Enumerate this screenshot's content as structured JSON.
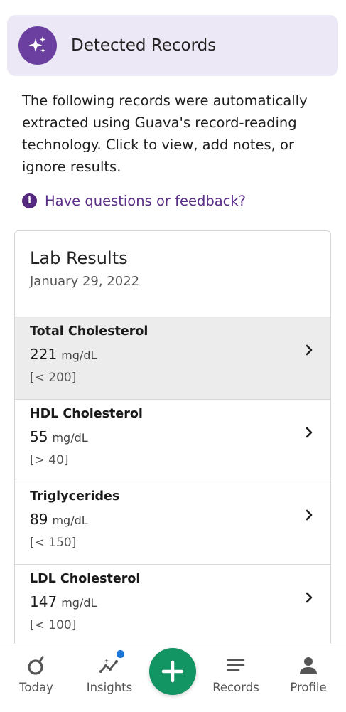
{
  "header": {
    "title": "Detected Records",
    "icon": "sparkle-icon",
    "badge_color": "#6b3fa0"
  },
  "intro_text": "The following records were automatically extracted using Guava's record-reading technology. Click to view, add notes, or ignore results.",
  "feedback_link": {
    "label": "Have questions or feedback?",
    "icon": "info-icon",
    "color": "#5a2d87"
  },
  "lab_results": {
    "title": "Lab Results",
    "date": "January 29, 2022",
    "items": [
      {
        "name": "Total Cholesterol",
        "value": "221",
        "unit": "mg/dL",
        "range": "[< 200]"
      },
      {
        "name": "HDL Cholesterol",
        "value": "55",
        "unit": "mg/dL",
        "range": "[> 40]"
      },
      {
        "name": "Triglycerides",
        "value": "89",
        "unit": "mg/dL",
        "range": "[< 150]"
      },
      {
        "name": "LDL Cholesterol",
        "value": "147",
        "unit": "mg/dL",
        "range": "[< 100]"
      }
    ]
  },
  "bottom_nav": {
    "items": [
      {
        "label": "Today",
        "icon": "today-icon"
      },
      {
        "label": "Insights",
        "icon": "insights-icon"
      },
      {
        "label": "Records",
        "icon": "records-icon"
      },
      {
        "label": "Profile",
        "icon": "profile-icon"
      }
    ],
    "add_button_icon": "plus-icon",
    "add_button_color": "#129463",
    "notification_dot_color": "#1b74d6"
  }
}
